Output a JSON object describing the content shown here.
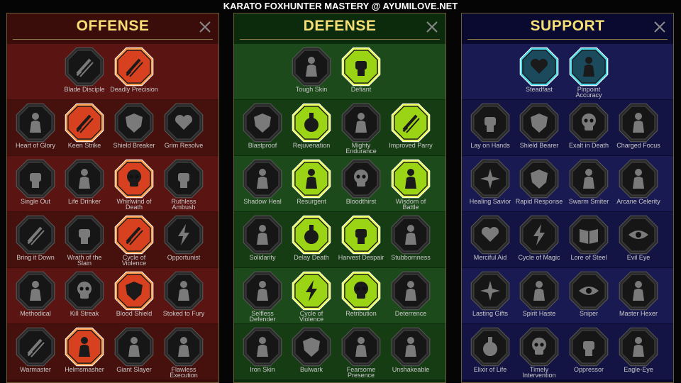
{
  "title": "KARATO FOXHUNTER MASTERY @ AYUMILOVE.NET",
  "panels": [
    {
      "id": "offense",
      "title": "OFFENSE",
      "bg": "#3a0c0a",
      "band": "#5a1411",
      "band2": "#46100d",
      "active_fill": "#d8411f",
      "active_glow": "#ff9a4a",
      "rows": [
        [
          {
            "name": "Blade Disciple",
            "active": false,
            "icon": "crossed-swords-icon"
          },
          {
            "name": "Deadly Precision",
            "active": true,
            "icon": "dagger-icon"
          }
        ],
        [
          {
            "name": "Heart of Glory",
            "active": false,
            "icon": "horned-helm-icon"
          },
          {
            "name": "Keen Strike",
            "active": true,
            "icon": "slash-icon"
          },
          {
            "name": "Shield Breaker",
            "active": false,
            "icon": "broken-shield-icon"
          },
          {
            "name": "Grim Resolve",
            "active": false,
            "icon": "heart-thorns-icon"
          }
        ],
        [
          {
            "name": "Single Out",
            "active": false,
            "icon": "target-fist-icon"
          },
          {
            "name": "Life Drinker",
            "active": false,
            "icon": "fangs-icon"
          },
          {
            "name": "Whirlwind of Death",
            "active": true,
            "icon": "whirl-skull-icon"
          },
          {
            "name": "Ruthless Ambush",
            "active": false,
            "icon": "raised-fist-icon"
          }
        ],
        [
          {
            "name": "Bring it Down",
            "active": false,
            "icon": "down-blade-icon"
          },
          {
            "name": "Wrath of the Slain",
            "active": false,
            "icon": "hammer-fist-icon"
          },
          {
            "name": "Cycle of Violence",
            "active": true,
            "icon": "axe-icon"
          },
          {
            "name": "Opportunist",
            "active": false,
            "icon": "chain-lightning-icon"
          }
        ],
        [
          {
            "name": "Methodical",
            "active": false,
            "icon": "spider-icon"
          },
          {
            "name": "Kill Streak",
            "active": false,
            "icon": "skull-icon"
          },
          {
            "name": "Blood Shield",
            "active": true,
            "icon": "sword-shield-icon"
          },
          {
            "name": "Stoked to Fury",
            "active": false,
            "icon": "fury-figure-icon"
          }
        ],
        [
          {
            "name": "Warmaster",
            "active": false,
            "icon": "sword-sparks-icon"
          },
          {
            "name": "Helmsmasher",
            "active": true,
            "icon": "helm-icon"
          },
          {
            "name": "Giant Slayer",
            "active": false,
            "icon": "giant-icon"
          },
          {
            "name": "Flawless Execution",
            "active": false,
            "icon": "executioner-icon"
          }
        ]
      ]
    },
    {
      "id": "defense",
      "title": "DEFENSE",
      "bg": "#0c2a0c",
      "band": "#1c4a1a",
      "band2": "#163c14",
      "active_fill": "#9ad414",
      "active_glow": "#e8ff5a",
      "rows": [
        [
          {
            "name": "Tough Skin",
            "active": false,
            "icon": "scales-icon"
          },
          {
            "name": "Defiant",
            "active": true,
            "icon": "fist-icon"
          }
        ],
        [
          {
            "name": "Blastproof",
            "active": false,
            "icon": "chevron-shield-icon"
          },
          {
            "name": "Rejuvenation",
            "active": true,
            "icon": "potion-icon"
          },
          {
            "name": "Mighty Endurance",
            "active": false,
            "icon": "muscle-icon"
          },
          {
            "name": "Improved Parry",
            "active": true,
            "icon": "parry-blades-icon"
          }
        ],
        [
          {
            "name": "Shadow Heal",
            "active": false,
            "icon": "shadow-figure-icon"
          },
          {
            "name": "Resurgent",
            "active": true,
            "icon": "knight-icon"
          },
          {
            "name": "Bloodthirst",
            "active": false,
            "icon": "heart-skull-icon"
          },
          {
            "name": "Wisdom of Battle",
            "active": true,
            "icon": "glowing-head-icon"
          }
        ],
        [
          {
            "name": "Solidarity",
            "active": false,
            "icon": "crowd-icon"
          },
          {
            "name": "Delay Death",
            "active": true,
            "icon": "hourglass-icon"
          },
          {
            "name": "Harvest Despair",
            "active": true,
            "icon": "open-hand-icon"
          },
          {
            "name": "Stubbornness",
            "active": false,
            "icon": "bull-icon"
          }
        ],
        [
          {
            "name": "Selfless Defender",
            "active": false,
            "icon": "dash-figure-icon"
          },
          {
            "name": "Cycle of Violence",
            "active": true,
            "icon": "flames-icon"
          },
          {
            "name": "Retribution",
            "active": true,
            "icon": "radiant-skull-icon"
          },
          {
            "name": "Deterrence",
            "active": false,
            "icon": "deflect-icon"
          }
        ],
        [
          {
            "name": "Iron Skin",
            "active": false,
            "icon": "iron-figure-icon"
          },
          {
            "name": "Bulwark",
            "active": false,
            "icon": "bulwark-shield-icon"
          },
          {
            "name": "Fearsome Presence",
            "active": false,
            "icon": "fearsome-face-icon"
          },
          {
            "name": "Unshakeable",
            "active": false,
            "icon": "sturdy-figure-icon"
          }
        ]
      ]
    },
    {
      "id": "support",
      "title": "SUPPORT",
      "bg": "#0a0a30",
      "band": "#1a1a52",
      "band2": "#131344",
      "active_fill": "#1b4a5c",
      "active_glow": "#4ad8e8",
      "rows": [
        [
          {
            "name": "Steadfast",
            "active": true,
            "icon": "hand-heart-icon"
          },
          {
            "name": "Pinpoint Accuracy",
            "active": true,
            "icon": "spiral-target-icon"
          }
        ],
        [
          {
            "name": "Lay on Hands",
            "active": false,
            "icon": "praying-hands-icon"
          },
          {
            "name": "Shield Bearer",
            "active": false,
            "icon": "ring-shield-icon"
          },
          {
            "name": "Exalt in Death",
            "active": false,
            "icon": "skull-drops-icon"
          },
          {
            "name": "Charged Focus",
            "active": false,
            "icon": "charge-arrow-icon"
          }
        ],
        [
          {
            "name": "Healing Savior",
            "active": false,
            "icon": "sparkle-figure-icon"
          },
          {
            "name": "Rapid Response",
            "active": false,
            "icon": "lightning-shield-icon"
          },
          {
            "name": "Swarm Smiter",
            "active": false,
            "icon": "swarm-icon"
          },
          {
            "name": "Arcane Celerity",
            "active": false,
            "icon": "double-figure-icon"
          }
        ],
        [
          {
            "name": "Merciful Aid",
            "active": false,
            "icon": "chained-heart-icon"
          },
          {
            "name": "Cycle of Magic",
            "active": false,
            "icon": "comet-icon"
          },
          {
            "name": "Lore of Steel",
            "active": false,
            "icon": "book-icon"
          },
          {
            "name": "Evil Eye",
            "active": false,
            "icon": "evil-eye-icon"
          }
        ],
        [
          {
            "name": "Lasting Gifts",
            "active": false,
            "icon": "star-icon"
          },
          {
            "name": "Spirit Haste",
            "active": false,
            "icon": "boot-icon"
          },
          {
            "name": "Sniper",
            "active": false,
            "icon": "eye-icon"
          },
          {
            "name": "Master Hexer",
            "active": false,
            "icon": "hex-figure-icon"
          }
        ],
        [
          {
            "name": "Elixir of Life",
            "active": false,
            "icon": "flask-icon"
          },
          {
            "name": "Timely Intervention",
            "active": false,
            "icon": "grim-skull-icon"
          },
          {
            "name": "Oppressor",
            "active": false,
            "icon": "gauntlet-icon"
          },
          {
            "name": "Eagle-Eye",
            "active": false,
            "icon": "eagle-icon"
          }
        ]
      ]
    }
  ]
}
